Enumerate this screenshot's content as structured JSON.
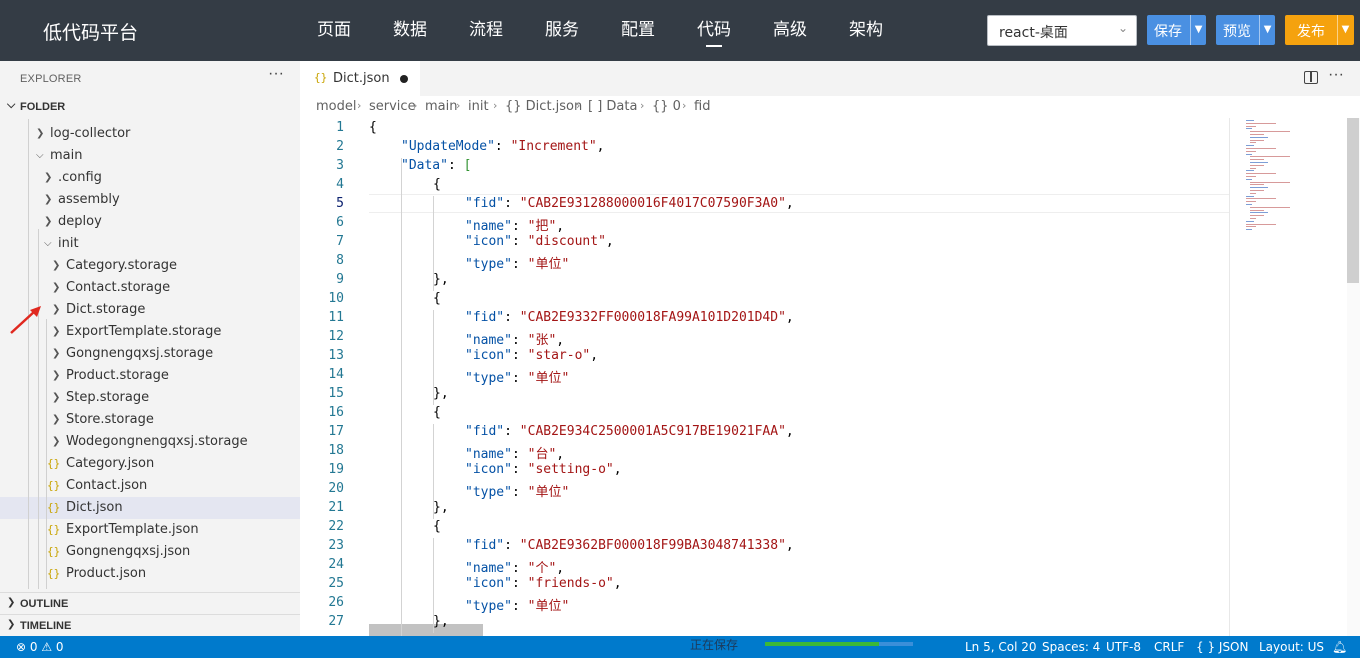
{
  "app": {
    "brand": "低代码平台",
    "nav": [
      "页面",
      "数据",
      "流程",
      "服务",
      "配置",
      "代码",
      "高级",
      "架构"
    ],
    "active_nav": "代码",
    "env_select": "react-桌面",
    "save_label": "保存",
    "preview_label": "预览",
    "publish_label": "发布",
    "colors": {
      "topbar": "#343c45",
      "save": "#4a90e2",
      "preview": "#4a90e2",
      "publish": "#f5a20e",
      "statusbar": "#007acc"
    }
  },
  "sidebar": {
    "title": "EXPLORER",
    "more": "···",
    "folder_label": "FOLDER",
    "tree": [
      {
        "label": "log-collector",
        "type": "folder",
        "expanded": false,
        "depth": 1
      },
      {
        "label": "main",
        "type": "folder",
        "expanded": true,
        "depth": 1
      },
      {
        "label": ".config",
        "type": "folder",
        "expanded": false,
        "depth": 2
      },
      {
        "label": "assembly",
        "type": "folder",
        "expanded": false,
        "depth": 2
      },
      {
        "label": "deploy",
        "type": "folder",
        "expanded": false,
        "depth": 2
      },
      {
        "label": "init",
        "type": "folder",
        "expanded": true,
        "depth": 2
      },
      {
        "label": "Category.storage",
        "type": "folder",
        "expanded": false,
        "depth": 3
      },
      {
        "label": "Contact.storage",
        "type": "folder",
        "expanded": false,
        "depth": 3
      },
      {
        "label": "Dict.storage",
        "type": "folder",
        "expanded": false,
        "depth": 3
      },
      {
        "label": "ExportTemplate.storage",
        "type": "folder",
        "expanded": false,
        "depth": 3
      },
      {
        "label": "Gongnengqxsj.storage",
        "type": "folder",
        "expanded": false,
        "depth": 3
      },
      {
        "label": "Product.storage",
        "type": "folder",
        "expanded": false,
        "depth": 3
      },
      {
        "label": "Step.storage",
        "type": "folder",
        "expanded": false,
        "depth": 3
      },
      {
        "label": "Store.storage",
        "type": "folder",
        "expanded": false,
        "depth": 3
      },
      {
        "label": "Wodegongnengqxsj.storage",
        "type": "folder",
        "expanded": false,
        "depth": 3
      },
      {
        "label": "Category.json",
        "type": "json",
        "depth": 3
      },
      {
        "label": "Contact.json",
        "type": "json",
        "depth": 3
      },
      {
        "label": "Dict.json",
        "type": "json",
        "depth": 3,
        "selected": true
      },
      {
        "label": "ExportTemplate.json",
        "type": "json",
        "depth": 3
      },
      {
        "label": "Gongnengqxsj.json",
        "type": "json",
        "depth": 3
      },
      {
        "label": "Product.json",
        "type": "json",
        "depth": 3
      }
    ],
    "outline_label": "OUTLINE",
    "timeline_label": "TIMELINE"
  },
  "editor": {
    "tab": {
      "label": "Dict.json",
      "icon": "json-braces-icon",
      "dirty": true
    },
    "breadcrumb": [
      "model",
      "service",
      "main",
      "init",
      "{} Dict.json",
      "[ ] Data",
      "{} 0",
      "fid"
    ],
    "current_line": 5,
    "lines": [
      {
        "n": 1,
        "indent": 0,
        "parts": [
          [
            "p",
            "{"
          ]
        ]
      },
      {
        "n": 2,
        "indent": 1,
        "parts": [
          [
            "k",
            "\"UpdateMode\""
          ],
          [
            "p",
            ": "
          ],
          [
            "s",
            "\"Increment\""
          ],
          [
            "p",
            ","
          ]
        ]
      },
      {
        "n": 3,
        "indent": 1,
        "parts": [
          [
            "k",
            "\"Data\""
          ],
          [
            "p",
            ": "
          ],
          [
            "b",
            "["
          ]
        ]
      },
      {
        "n": 4,
        "indent": 2,
        "parts": [
          [
            "p",
            "{"
          ]
        ]
      },
      {
        "n": 5,
        "indent": 3,
        "parts": [
          [
            "k",
            "\"fid\""
          ],
          [
            "p",
            ": "
          ],
          [
            "s",
            "\"CAB2E931288000016F4017C07590F3A0\""
          ],
          [
            "p",
            ","
          ]
        ]
      },
      {
        "n": 6,
        "indent": 3,
        "parts": [
          [
            "k",
            "\"name\""
          ],
          [
            "p",
            ": "
          ],
          [
            "s",
            "\"把\""
          ],
          [
            "p",
            ","
          ]
        ]
      },
      {
        "n": 7,
        "indent": 3,
        "parts": [
          [
            "k",
            "\"icon\""
          ],
          [
            "p",
            ": "
          ],
          [
            "s",
            "\"discount\""
          ],
          [
            "p",
            ","
          ]
        ]
      },
      {
        "n": 8,
        "indent": 3,
        "parts": [
          [
            "k",
            "\"type\""
          ],
          [
            "p",
            ": "
          ],
          [
            "s",
            "\"单位\""
          ]
        ]
      },
      {
        "n": 9,
        "indent": 2,
        "parts": [
          [
            "p",
            "},"
          ]
        ]
      },
      {
        "n": 10,
        "indent": 2,
        "parts": [
          [
            "p",
            "{"
          ]
        ]
      },
      {
        "n": 11,
        "indent": 3,
        "parts": [
          [
            "k",
            "\"fid\""
          ],
          [
            "p",
            ": "
          ],
          [
            "s",
            "\"CAB2E9332FF000018FA99A101D201D4D\""
          ],
          [
            "p",
            ","
          ]
        ]
      },
      {
        "n": 12,
        "indent": 3,
        "parts": [
          [
            "k",
            "\"name\""
          ],
          [
            "p",
            ": "
          ],
          [
            "s",
            "\"张\""
          ],
          [
            "p",
            ","
          ]
        ]
      },
      {
        "n": 13,
        "indent": 3,
        "parts": [
          [
            "k",
            "\"icon\""
          ],
          [
            "p",
            ": "
          ],
          [
            "s",
            "\"star-o\""
          ],
          [
            "p",
            ","
          ]
        ]
      },
      {
        "n": 14,
        "indent": 3,
        "parts": [
          [
            "k",
            "\"type\""
          ],
          [
            "p",
            ": "
          ],
          [
            "s",
            "\"单位\""
          ]
        ]
      },
      {
        "n": 15,
        "indent": 2,
        "parts": [
          [
            "p",
            "},"
          ]
        ]
      },
      {
        "n": 16,
        "indent": 2,
        "parts": [
          [
            "p",
            "{"
          ]
        ]
      },
      {
        "n": 17,
        "indent": 3,
        "parts": [
          [
            "k",
            "\"fid\""
          ],
          [
            "p",
            ": "
          ],
          [
            "s",
            "\"CAB2E934C2500001A5C917BE19021FAA\""
          ],
          [
            "p",
            ","
          ]
        ]
      },
      {
        "n": 18,
        "indent": 3,
        "parts": [
          [
            "k",
            "\"name\""
          ],
          [
            "p",
            ": "
          ],
          [
            "s",
            "\"台\""
          ],
          [
            "p",
            ","
          ]
        ]
      },
      {
        "n": 19,
        "indent": 3,
        "parts": [
          [
            "k",
            "\"icon\""
          ],
          [
            "p",
            ": "
          ],
          [
            "s",
            "\"setting-o\""
          ],
          [
            "p",
            ","
          ]
        ]
      },
      {
        "n": 20,
        "indent": 3,
        "parts": [
          [
            "k",
            "\"type\""
          ],
          [
            "p",
            ": "
          ],
          [
            "s",
            "\"单位\""
          ]
        ]
      },
      {
        "n": 21,
        "indent": 2,
        "parts": [
          [
            "p",
            "},"
          ]
        ]
      },
      {
        "n": 22,
        "indent": 2,
        "parts": [
          [
            "p",
            "{"
          ]
        ]
      },
      {
        "n": 23,
        "indent": 3,
        "parts": [
          [
            "k",
            "\"fid\""
          ],
          [
            "p",
            ": "
          ],
          [
            "s",
            "\"CAB2E9362BF000018F99BA3048741338\""
          ],
          [
            "p",
            ","
          ]
        ]
      },
      {
        "n": 24,
        "indent": 3,
        "parts": [
          [
            "k",
            "\"name\""
          ],
          [
            "p",
            ": "
          ],
          [
            "s",
            "\"个\""
          ],
          [
            "p",
            ","
          ]
        ]
      },
      {
        "n": 25,
        "indent": 3,
        "parts": [
          [
            "k",
            "\"icon\""
          ],
          [
            "p",
            ": "
          ],
          [
            "s",
            "\"friends-o\""
          ],
          [
            "p",
            ","
          ]
        ]
      },
      {
        "n": 26,
        "indent": 3,
        "parts": [
          [
            "k",
            "\"type\""
          ],
          [
            "p",
            ": "
          ],
          [
            "s",
            "\"单位\""
          ]
        ]
      },
      {
        "n": 27,
        "indent": 2,
        "parts": [
          [
            "p",
            "},"
          ]
        ]
      }
    ]
  },
  "statusbar": {
    "problems": "⊗ 0 ⚠ 0",
    "toast": "正在保存",
    "progress": 0.77,
    "position": "Ln 5, Col 20",
    "spaces": "Spaces: 4",
    "encoding": "UTF-8",
    "eol": "CRLF",
    "language": "{ } JSON",
    "layout": "Layout: US",
    "bell_icon": "bell-icon"
  }
}
